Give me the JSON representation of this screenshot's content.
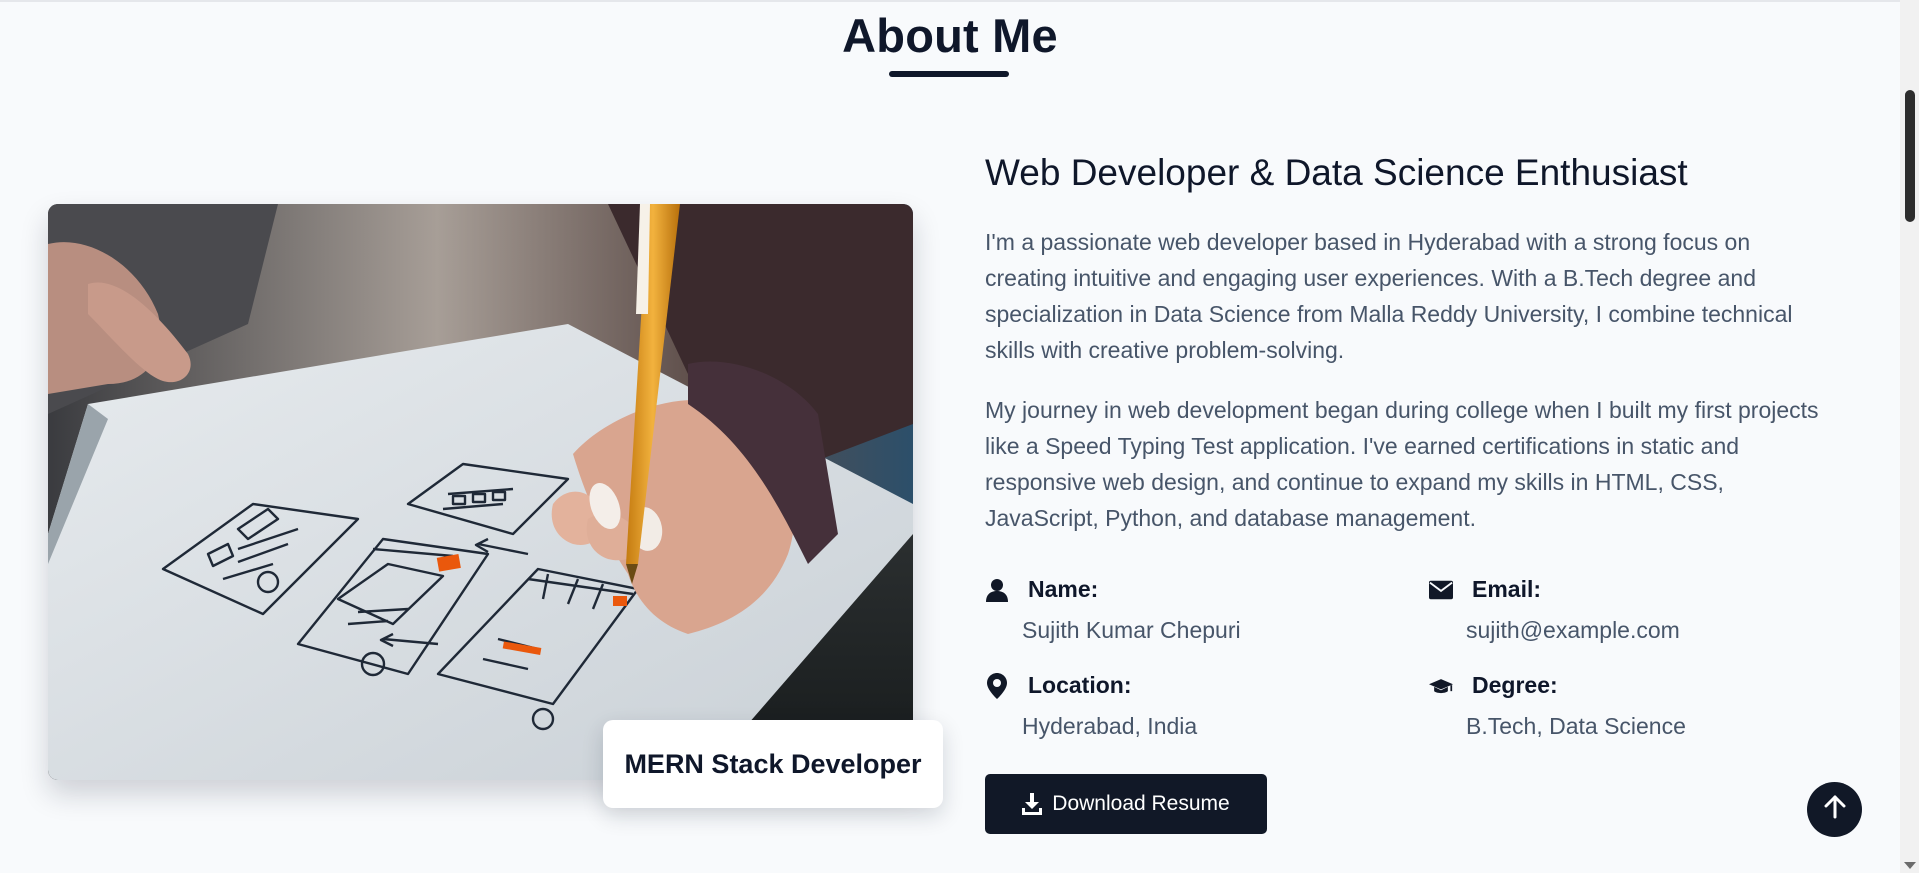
{
  "section": {
    "title": "About Me"
  },
  "image": {
    "badge": "MERN Stack Developer"
  },
  "about": {
    "heading": "Web Developer & Data Science Enthusiast",
    "paragraph_1": "I'm a passionate web developer based in Hyderabad with a strong focus on creating intuitive and engaging user experiences. With a B.Tech degree and specialization in Data Science from Malla Reddy University, I combine technical skills with creative problem-solving.",
    "paragraph_2": "My journey in web development began during college when I built my first projects like a Speed Typing Test application. I've earned certifications in static and responsive web design, and continue to expand my skills in HTML, CSS, JavaScript, Python, and database management."
  },
  "info": {
    "name": {
      "label": "Name:",
      "value": "Sujith Kumar Chepuri",
      "icon": "user-icon"
    },
    "email": {
      "label": "Email:",
      "value": "sujith@example.com",
      "icon": "envelope-icon"
    },
    "location": {
      "label": "Location:",
      "value": "Hyderabad, India",
      "icon": "map-pin-icon"
    },
    "degree": {
      "label": "Degree:",
      "value": "B.Tech, Data Science",
      "icon": "graduation-cap-icon"
    }
  },
  "actions": {
    "download_label": "Download Resume",
    "download_icon": "download-icon",
    "to_top_icon": "arrow-up-icon"
  },
  "colors": {
    "primary": "#111827",
    "text_muted": "#475569",
    "background": "#f8fafc"
  }
}
